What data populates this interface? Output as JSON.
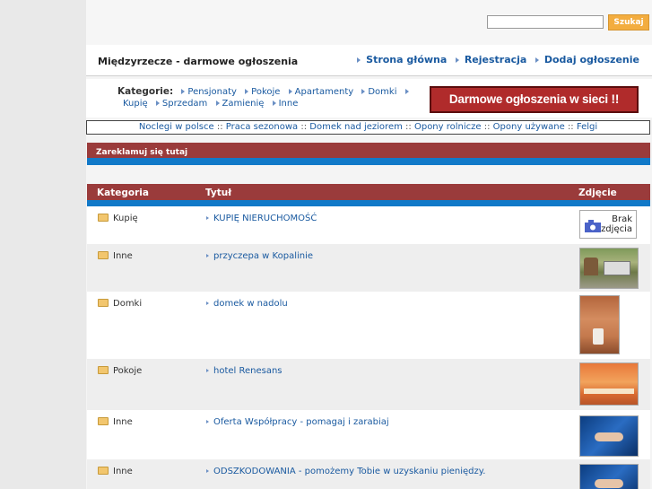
{
  "search": {
    "placeholder": "",
    "button_label": "Szukaj"
  },
  "header": {
    "site_title": "Międzyrzecze - darmowe ogłoszenia",
    "nav": [
      "Strona główna",
      "Rejestracja",
      "Dodaj ogłoszenie"
    ]
  },
  "categories": {
    "label": "Kategorie:",
    "items": [
      "Pensjonaty",
      "Pokoje",
      "Apartamenty",
      "Domki",
      "Kupię",
      "Sprzedam",
      "Zamienię",
      "Inne"
    ]
  },
  "banner": {
    "text": "Darmowe ogłoszenia w sieci !!"
  },
  "links": [
    "Noclegi w polsce",
    "Praca sezonowa",
    "Domek nad jeziorem",
    "Opony rolnicze",
    "Opony używane",
    "Felgi"
  ],
  "ad_bar": {
    "text": "Zareklamuj się tutaj"
  },
  "table": {
    "headers": [
      "Kategoria",
      "Tytuł",
      "Zdjęcie"
    ],
    "rows": [
      {
        "category": "Kupię",
        "title": "KUPIĘ NIERUCHOMOŚĆ",
        "photo": "no-photo",
        "no_photo_text": "Brak zdjęcia"
      },
      {
        "category": "Inne",
        "title": "przyczepa w Kopalinie",
        "photo": "trailer-photo"
      },
      {
        "category": "Domki",
        "title": "domek w nadolu",
        "photo": "bathroom-photo"
      },
      {
        "category": "Pokoje",
        "title": "hotel Renesans",
        "photo": "hall-photo"
      },
      {
        "category": "Inne",
        "title": "Oferta Współpracy - pomagaj i zarabiaj",
        "photo": "handshake-photo"
      },
      {
        "category": "Inne",
        "title": "ODSZKODOWANIA - pomożemy Tobie w uzyskaniu pieniędzy.",
        "photo": "handshake-photo-2"
      }
    ]
  },
  "colors": {
    "accent_red": "#9a3b3b",
    "accent_blue": "#1179c8",
    "link": "#1a5aa0",
    "button": "#f3ad3f"
  }
}
